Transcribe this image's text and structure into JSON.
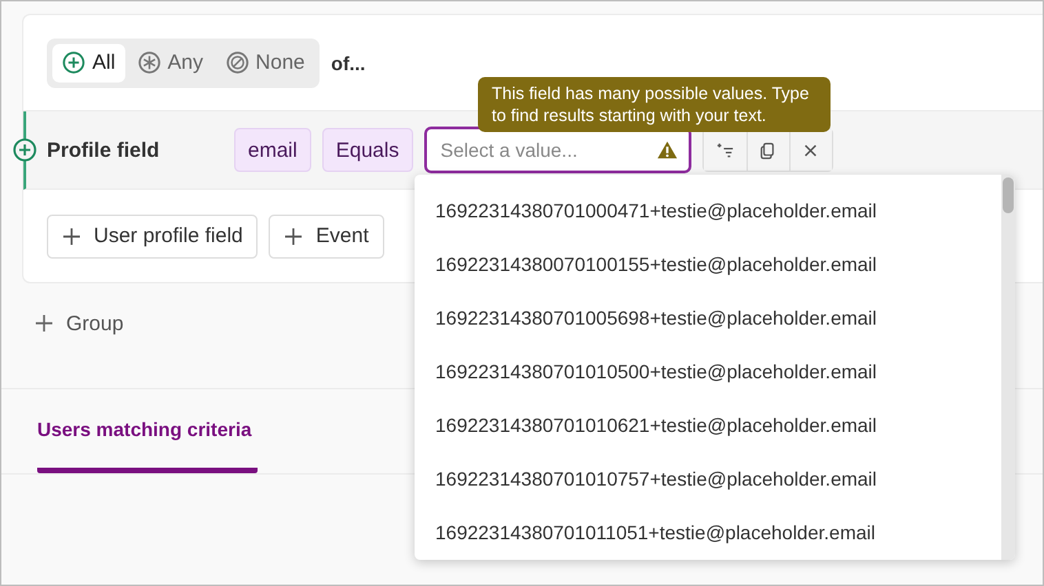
{
  "match_mode": {
    "options": [
      {
        "label": "All",
        "kind": "plus",
        "selected": true
      },
      {
        "label": "Any",
        "kind": "asterisk",
        "selected": false
      },
      {
        "label": "None",
        "kind": "ban",
        "selected": false
      }
    ],
    "suffix": "of..."
  },
  "condition": {
    "label": "Profile field",
    "chips": [
      "email",
      "Equals"
    ],
    "value_field": {
      "placeholder": "Select a value...",
      "warning": true
    },
    "actions": [
      {
        "kind": "filter"
      },
      {
        "kind": "copy"
      },
      {
        "kind": "close"
      }
    ]
  },
  "tooltip": "This field has many possible values. Type to find results starting with your text.",
  "add_buttons": [
    "User profile field",
    "Event"
  ],
  "add_group": "Group",
  "tabs": [
    {
      "label": "Users matching criteria",
      "selected": true
    }
  ],
  "dropdown": {
    "options": [
      "16922314380701000471+testie@placeholder.email",
      "16922314380070100155+testie@placeholder.email",
      "16922314380701005698+testie@placeholder.email",
      "16922314380701010500+testie@placeholder.email",
      "16922314380701010621+testie@placeholder.email",
      "16922314380701010757+testie@placeholder.email",
      "16922314380701011051+testie@placeholder.email"
    ]
  }
}
